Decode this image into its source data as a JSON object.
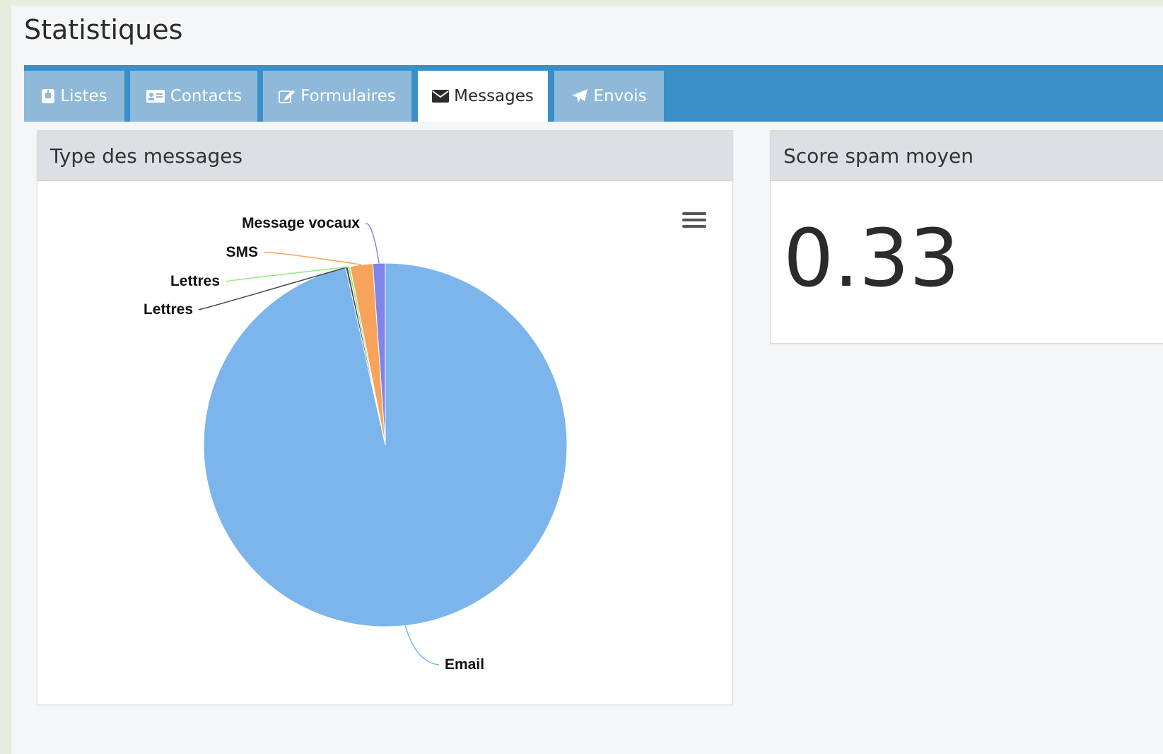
{
  "page": {
    "title": "Statistiques"
  },
  "tabs": [
    {
      "label": "Listes",
      "icon": "list-icon",
      "active": false
    },
    {
      "label": "Contacts",
      "icon": "contact-card-icon",
      "active": false
    },
    {
      "label": "Formulaires",
      "icon": "edit-icon",
      "active": false
    },
    {
      "label": "Messages",
      "icon": "envelope-icon",
      "active": true
    },
    {
      "label": "Envois",
      "icon": "paper-plane-icon",
      "active": false
    }
  ],
  "cards": {
    "message_types": {
      "title": "Type des messages",
      "menu_icon": "hamburger-menu-icon"
    },
    "spam_score": {
      "title": "Score spam moyen",
      "value": "0.33"
    }
  },
  "chart_data": {
    "type": "pie",
    "title": "",
    "slices": [
      {
        "name": "Email",
        "value": 96.5,
        "color": "#7cb5ec"
      },
      {
        "name": "Lettres",
        "value": 0.2,
        "color": "#434348"
      },
      {
        "name": "Lettres",
        "value": 0.2,
        "color": "#90ed7d"
      },
      {
        "name": "SMS",
        "value": 2.0,
        "color": "#f7a35c"
      },
      {
        "name": "Message vocaux",
        "value": 1.1,
        "color": "#8085e9"
      }
    ]
  },
  "colors": {
    "tabbar": "#3a8fc7",
    "tab_inactive": "#8fb9d8"
  }
}
